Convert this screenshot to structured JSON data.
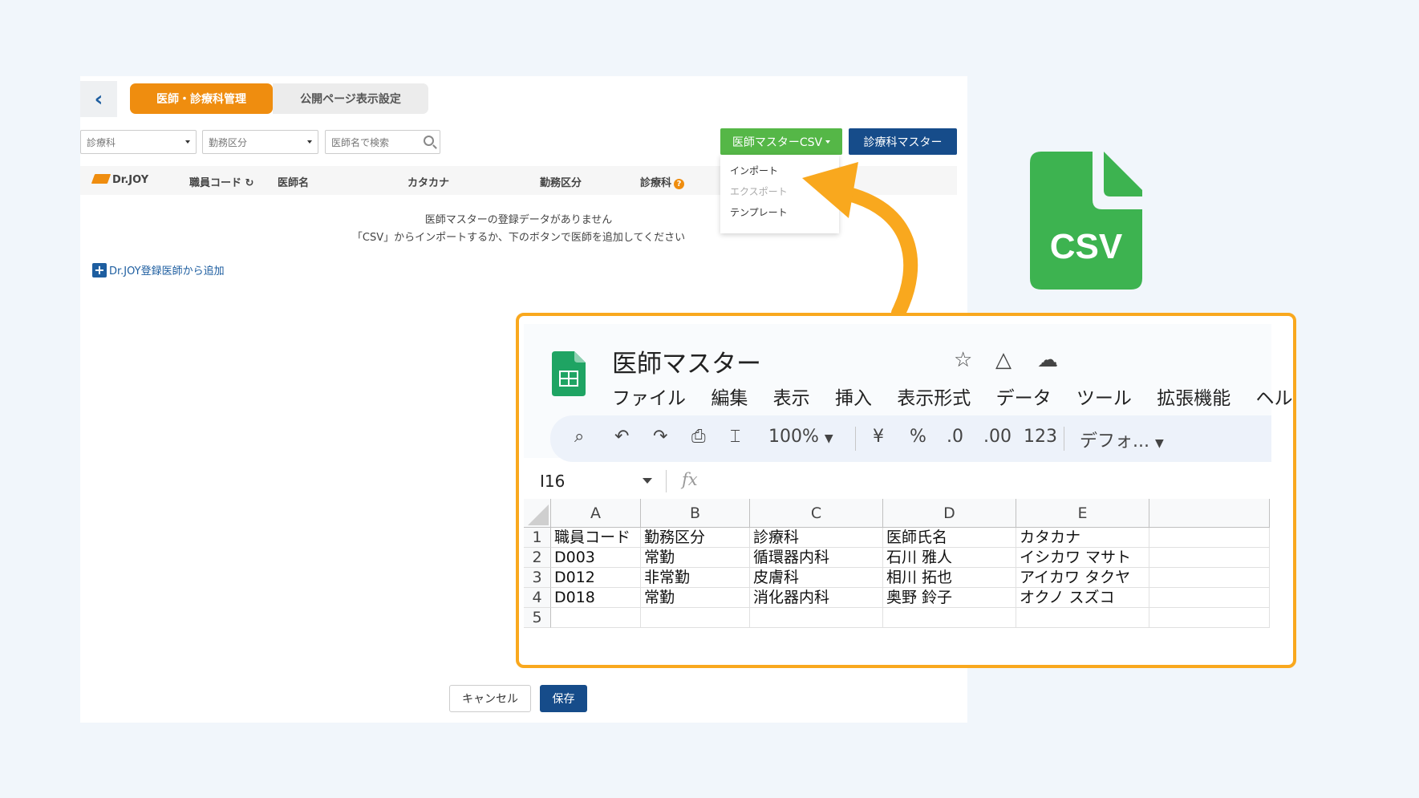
{
  "admin": {
    "back_icon": "chevron-left-icon",
    "tabs": [
      {
        "label": "医師・診療科管理",
        "active": true
      },
      {
        "label": "公開ページ表示設定",
        "active": false
      }
    ],
    "filters": {
      "department_placeholder": "診療科",
      "employment_placeholder": "勤務区分",
      "search_placeholder": "医師名で検索"
    },
    "csv_button": "医師マスターCSV",
    "dept_master_button": "診療科マスター",
    "csv_menu": [
      {
        "label": "インポート",
        "enabled": true
      },
      {
        "label": "エクスポート",
        "enabled": false
      },
      {
        "label": "テンプレート",
        "enabled": true
      }
    ],
    "table_headers": {
      "brand": "Dr.JOY",
      "staff_code": "職員コード",
      "doctor_name": "医師名",
      "katakana": "カタカナ",
      "employment": "勤務区分",
      "department": "診療科"
    },
    "empty_message_1": "医師マスターの登録データがありません",
    "empty_message_2": "「CSV」からインポートするか、下のボタンで医師を追加してください",
    "add_link": "Dr.JOY登録医師から追加",
    "cancel_button": "キャンセル",
    "save_button": "保存"
  },
  "csv_icon": {
    "label": "CSV",
    "color": "#3db350"
  },
  "spreadsheet": {
    "title": "医師マスター",
    "menu": [
      "ファイル",
      "編集",
      "表示",
      "挿入",
      "表示形式",
      "データ",
      "ツール",
      "拡張機能",
      "ヘル"
    ],
    "toolbar": {
      "zoom": "100%",
      "currency": "¥",
      "percent": "%",
      "dec_decrease": ".0",
      "dec_increase": ".00",
      "number_format": "123",
      "font": "デフォ..."
    },
    "cell_ref": "I16",
    "fx": "fx",
    "columns": [
      "A",
      "B",
      "C",
      "D",
      "E"
    ],
    "rows": [
      {
        "num": "1",
        "cells": [
          "職員コード",
          "勤務区分",
          "診療科",
          "医師氏名",
          "カタカナ"
        ]
      },
      {
        "num": "2",
        "cells": [
          "D003",
          "常勤",
          "循環器内科",
          "石川 雅人",
          "イシカワ マサト"
        ]
      },
      {
        "num": "3",
        "cells": [
          "D012",
          "非常勤",
          "皮膚科",
          "相川 拓也",
          "アイカワ タクヤ"
        ]
      },
      {
        "num": "4",
        "cells": [
          "D018",
          "常勤",
          "消化器内科",
          "奥野 鈴子",
          "オクノ スズコ"
        ]
      },
      {
        "num": "5",
        "cells": [
          "",
          "",
          "",
          "",
          ""
        ]
      }
    ]
  },
  "colors": {
    "accent_orange": "#ef8d0f",
    "primary_navy": "#164c8a",
    "csv_green": "#55b747",
    "highlight_border": "#f9a81e"
  }
}
